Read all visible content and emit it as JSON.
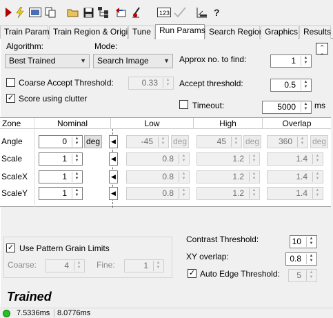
{
  "toolbar": {
    "icons": [
      "run-icon",
      "flash-icon",
      "grab-image-icon",
      "copy-icon",
      "open-folder-icon",
      "save-icon",
      "tree-icon",
      "undo-icon",
      "pointer-icon",
      "number-123-icon",
      "checkmark-icon",
      "scale-icon",
      "help-icon"
    ]
  },
  "tabs": [
    "Train Params",
    "Train Region & Origin",
    "Tune",
    "Run Params",
    "Search Region",
    "Graphics",
    "Results"
  ],
  "active_tab": "Run Params",
  "algorithm": {
    "label": "Algorithm:",
    "value": "Best Trained"
  },
  "mode": {
    "label": "Mode:",
    "value": "Search Image"
  },
  "approx": {
    "label": "Approx no. to find:",
    "value": "1"
  },
  "coarse_accept": {
    "label": "Coarse Accept Threshold:",
    "value": "0.33",
    "checked": false
  },
  "accept": {
    "label": "Accept threshold:",
    "value": "0.5"
  },
  "clutter": {
    "label": "Score using clutter",
    "checked": true
  },
  "timeout": {
    "label": "Timeout:",
    "value": "5000",
    "unit": "ms",
    "checked": false
  },
  "grid": {
    "headers": [
      "Zone",
      "Nominal",
      "Low",
      "High",
      "Overlap"
    ],
    "rows": [
      {
        "zone": "Angle",
        "nominal": "0",
        "unit": "deg",
        "low": "-45",
        "high": "45",
        "overlap": "360"
      },
      {
        "zone": "Scale",
        "nominal": "1",
        "unit": "",
        "low": "0.8",
        "high": "1.2",
        "overlap": "1.4"
      },
      {
        "zone": "ScaleX",
        "nominal": "1",
        "unit": "",
        "low": "0.8",
        "high": "1.2",
        "overlap": "1.4"
      },
      {
        "zone": "ScaleY",
        "nominal": "1",
        "unit": "",
        "low": "0.8",
        "high": "1.2",
        "overlap": "1.4"
      }
    ]
  },
  "pattern_grain": {
    "label": "Use Pattern Grain Limits",
    "checked": true,
    "coarse_label": "Coarse:",
    "coarse_value": "4",
    "fine_label": "Fine:",
    "fine_value": "1"
  },
  "contrast": {
    "label": "Contrast Threshold:",
    "value": "10"
  },
  "xy_overlap": {
    "label": "XY overlap:",
    "value": "0.8"
  },
  "auto_edge": {
    "label": "Auto Edge Threshold:",
    "value": "5",
    "checked": true
  },
  "trained_label": "Trained",
  "status": {
    "time1": "7.5336ms",
    "time2": "8.0776ms",
    "indicator_color": "#22c222"
  }
}
